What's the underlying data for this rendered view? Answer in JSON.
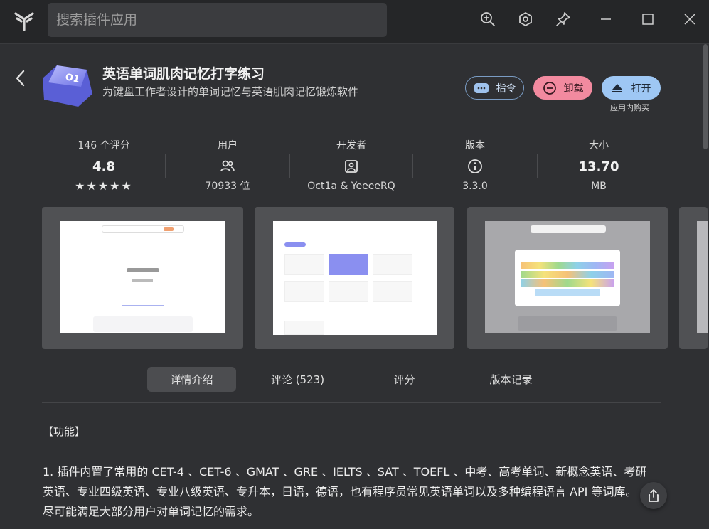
{
  "topbar": {
    "search_placeholder": "搜索插件应用"
  },
  "app": {
    "name": "英语单词肌肉记忆打字练习",
    "description": "为键盘工作者设计的单词记忆与英语肌肉记忆锻炼软件",
    "buttons": {
      "command": "指令",
      "uninstall": "卸载",
      "open": "打开"
    },
    "purchase_note": "应用内购买"
  },
  "stats": {
    "rating": {
      "label": "146 个评分",
      "value": "4.8",
      "stars": "★★★★★"
    },
    "users": {
      "label": "用户",
      "value": "70933 位"
    },
    "developer": {
      "label": "开发者",
      "value": "Oct1a & YeeeeRQ"
    },
    "version": {
      "label": "版本",
      "value": "3.3.0"
    },
    "size": {
      "label": "大小",
      "value": "13.70",
      "unit": "MB"
    }
  },
  "screenshots": [
    "screenshot-1",
    "screenshot-2",
    "screenshot-3",
    "screenshot-4"
  ],
  "tabs": [
    "详情介绍",
    "评论 (523)",
    "评分",
    "版本记录"
  ],
  "content": {
    "section_title": "【功能】",
    "paragraph": "1. 插件内置了常用的 CET-4 、CET-6 、GMAT 、GRE 、IELTS 、SAT 、TOEFL 、中考、高考单词、新概念英语、考研英语、专业四级英语、专业八级英语、专升本，日语，德语，也有程序员常见英语单词以及多种编程语言 API 等词库。 尽可能满足大部分用户对单词记忆的需求。"
  },
  "colors": {
    "background": "#2f3033",
    "topbar": "#252628",
    "uninstall": "#f28a9f",
    "open": "#9ec7f4",
    "icon_accent": "#8a8ff0"
  }
}
